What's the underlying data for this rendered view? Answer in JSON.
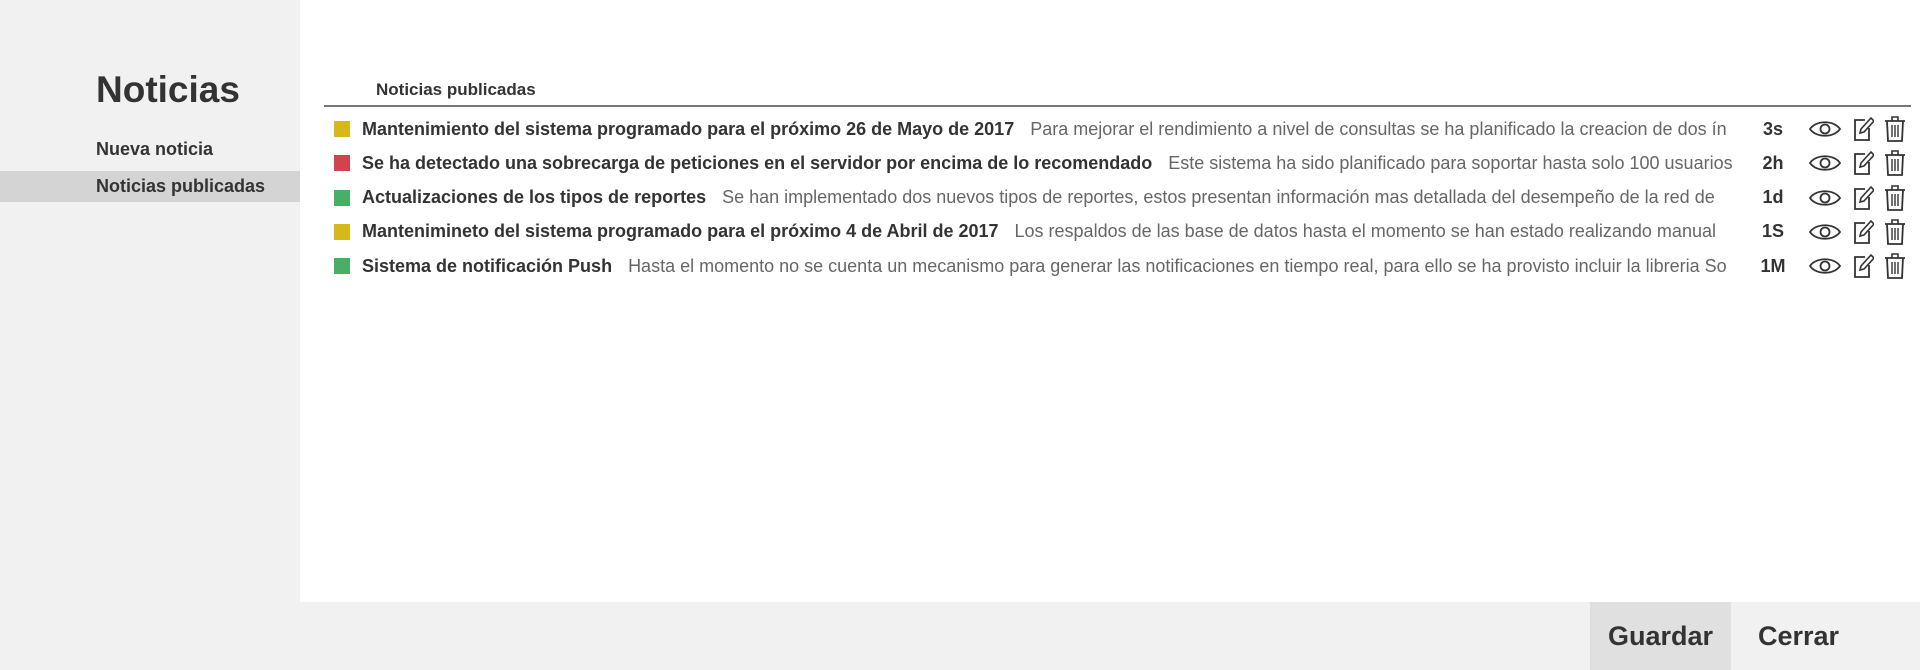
{
  "sidebar": {
    "title": "Noticias",
    "items": [
      {
        "label": "Nueva noticia",
        "active": false
      },
      {
        "label": "Noticias publicadas",
        "active": true
      }
    ]
  },
  "list": {
    "header": "Noticias publicadas",
    "rows": [
      {
        "status_color": "#d4b81c",
        "title": "Mantenimiento del sistema programado para el próximo 26 de Mayo de 2017",
        "snippet": "Para mejorar el rendimiento  a nivel de consultas se ha planificado la creacion de dos ín",
        "age": "3s"
      },
      {
        "status_color": "#d2444c",
        "title": "Se ha detectado una sobrecarga de peticiones en el servidor por encima de lo recomendado",
        "snippet": "Este sistema ha sido planificado para soportar hasta solo 100 usuarios",
        "age": "2h"
      },
      {
        "status_color": "#47b065",
        "title": "Actualizaciones de los tipos de reportes",
        "snippet": "Se han implementado dos nuevos tipos de reportes, estos presentan información mas detallada del desempeño de la red de",
        "age": "1d"
      },
      {
        "status_color": "#d4b81c",
        "title": "Mantenimineto del sistema programado para el próximo 4 de Abril de 2017",
        "snippet": "Los respaldos de las base de datos hasta el momento se han estado realizando manual",
        "age": "1S"
      },
      {
        "status_color": "#47b065",
        "title": "Sistema de notificación Push",
        "snippet": "Hasta el momento no se cuenta un mecanismo para generar las notificaciones en tiempo real, para ello se ha provisto incluir la libreria So",
        "age": "1M"
      }
    ],
    "row_actions": [
      "eye-icon",
      "edit-icon",
      "trash-icon"
    ]
  },
  "footer": {
    "save_label": "Guardar",
    "close_label": "Cerrar"
  }
}
